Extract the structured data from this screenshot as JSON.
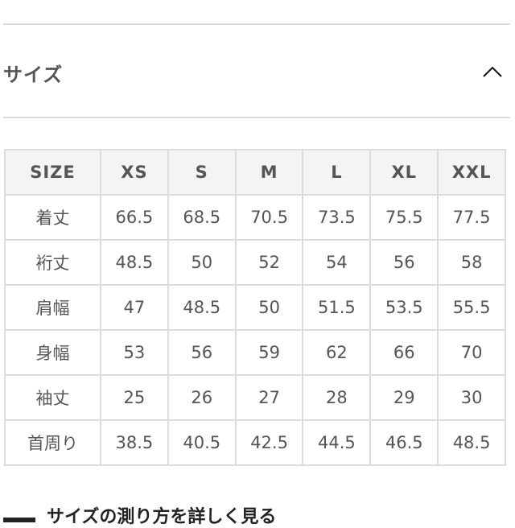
{
  "section": {
    "title": "サイズ",
    "toggle_icon": "chevron-up-icon",
    "expanded": true
  },
  "table": {
    "header_label": "SIZE",
    "sizes": [
      "XS",
      "S",
      "M",
      "L",
      "XL",
      "XXL"
    ],
    "rows": [
      {
        "label": "着丈",
        "values": [
          "66.5",
          "68.5",
          "70.5",
          "73.5",
          "75.5",
          "77.5"
        ]
      },
      {
        "label": "裄丈",
        "values": [
          "48.5",
          "50",
          "52",
          "54",
          "56",
          "58"
        ]
      },
      {
        "label": "肩幅",
        "values": [
          "47",
          "48.5",
          "50",
          "51.5",
          "53.5",
          "55.5"
        ]
      },
      {
        "label": "身幅",
        "values": [
          "53",
          "56",
          "59",
          "62",
          "66",
          "70"
        ]
      },
      {
        "label": "袖丈",
        "values": [
          "25",
          "26",
          "27",
          "28",
          "29",
          "30"
        ]
      },
      {
        "label": "首周り",
        "values": [
          "38.5",
          "40.5",
          "42.5",
          "44.5",
          "46.5",
          "48.5"
        ]
      }
    ]
  },
  "link": {
    "icon": "ruler-icon",
    "label": "サイズの測り方を詳しく見る"
  }
}
